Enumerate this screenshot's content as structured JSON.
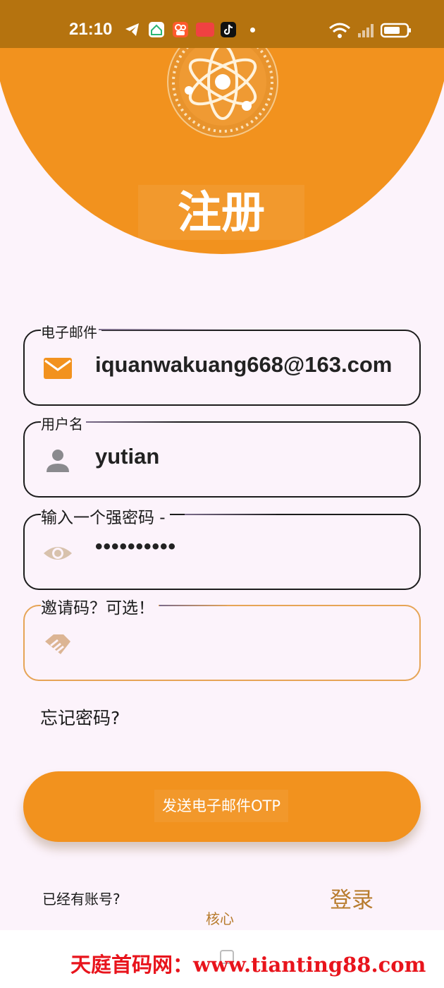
{
  "status_bar": {
    "time": "21:10"
  },
  "header": {
    "title": "注册"
  },
  "form": {
    "email": {
      "label": "电子邮件",
      "value": "iquanwakuang668@163.com",
      "icon": "mail-icon"
    },
    "username": {
      "label": "用户名",
      "value": "yutian",
      "icon": "person-icon"
    },
    "password": {
      "label": "输入一个强密码 -",
      "value": "••••••••••",
      "icon": "eye-icon"
    },
    "invite": {
      "label": "邀请码？可选！",
      "value": "",
      "icon": "handshake-icon"
    }
  },
  "forgot_password": "忘记密码?",
  "send_otp_button": "发送电子邮件OTP",
  "footer": {
    "have_account": "已经有账号?",
    "login_link": "登录",
    "core_label": "核心"
  },
  "watermark": "天庭首码网：www.tianting88.com",
  "colors": {
    "accent": "#f2921e",
    "status_bar": "#b5730f",
    "background": "#fcf3fb",
    "link": "#b87c2e",
    "watermark": "#e8141c"
  }
}
